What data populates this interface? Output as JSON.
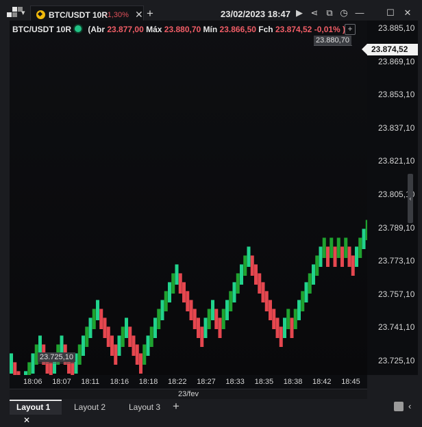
{
  "tab": {
    "symbol": "BTC/USDT 10R",
    "change": "-1,30%"
  },
  "datetime": "23/02/2023 18:47",
  "legend": {
    "name": "BTC/USDT 10R",
    "open_label": "(Abr",
    "open": "23.877,00",
    "high_label": "Máx",
    "high": "23.880,70",
    "low_label": "Mín",
    "low": "23.866,50",
    "close_label": "Fch",
    "close": "23.874,52",
    "change": "-0,01% )"
  },
  "price_axis": [
    "23.885,10",
    "23.869,10",
    "23.853,10",
    "23.837,10",
    "23.821,10",
    "23.805,10",
    "23.789,10",
    "23.773,10",
    "23.757,10",
    "23.741,10",
    "23.725,10"
  ],
  "current_price": "23.874,52",
  "high_marker": "23.880,70",
  "low_marker": "23.725,10",
  "time_axis": [
    "18:06",
    "18:07",
    "18:11",
    "18:16",
    "18:18",
    "18:22",
    "18:27",
    "18:33",
    "18:35",
    "18:38",
    "18:42",
    "18:45"
  ],
  "date_label": "23/fev",
  "layout_tabs": [
    "Layout 1",
    "Layout 2",
    "Layout 3"
  ],
  "colors": {
    "up_light": "#21d38c",
    "up_dark": "#1fa22f",
    "down": "#e5474f",
    "background": "#0c0d10"
  },
  "chart_data": {
    "type": "renko",
    "box_size": 10,
    "bricks": [
      1,
      -1,
      -1,
      -1,
      1,
      1,
      1,
      1,
      1,
      -1,
      -1,
      -1,
      1,
      1,
      1,
      -1,
      -1,
      -1,
      1,
      1,
      1,
      1,
      1,
      1,
      1,
      -1,
      -1,
      -1,
      -1,
      -1,
      1,
      1,
      1,
      -1,
      -1,
      -1,
      -1,
      1,
      1,
      1,
      1,
      1,
      1,
      1,
      1,
      1,
      1,
      -1,
      -1,
      -1,
      -1,
      -1,
      -1,
      -1,
      1,
      1,
      1,
      -1,
      -1,
      1,
      1,
      1,
      1,
      1,
      1,
      1,
      1,
      -1,
      -1,
      -1,
      -1,
      -1,
      -1,
      -1,
      -1,
      -1,
      1,
      1,
      -1,
      1,
      1,
      1,
      1,
      1,
      1,
      1,
      1,
      1,
      -1,
      1,
      -1,
      1,
      -1,
      1,
      -1,
      -1,
      1,
      1,
      1,
      1,
      -1
    ],
    "low_price": 23725.1,
    "high_price": 23880.7,
    "last_price": 23874.52
  }
}
